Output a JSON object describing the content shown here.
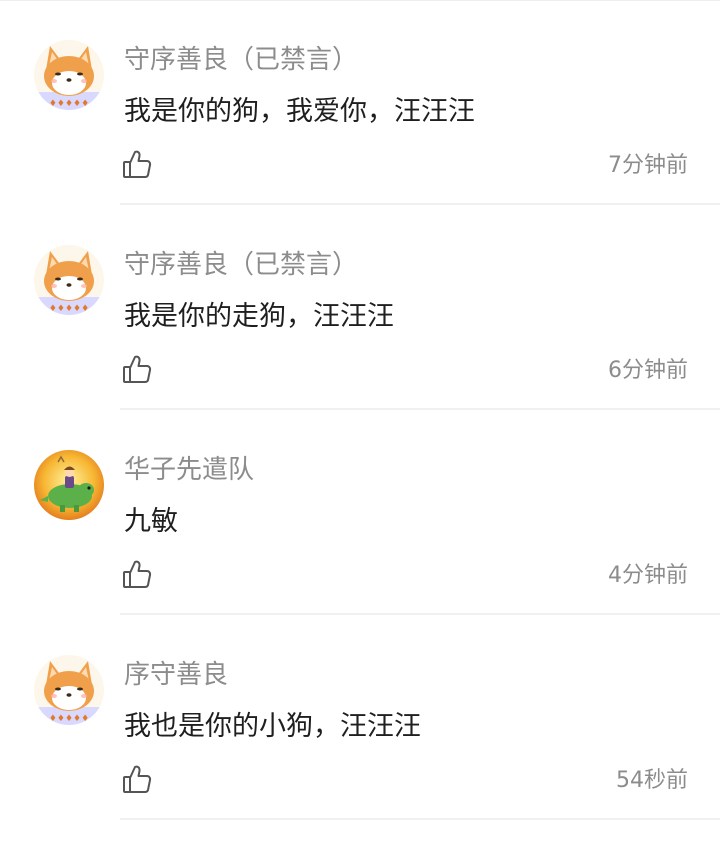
{
  "comments": [
    {
      "username": "守序善良（已禁言）",
      "content": "我是你的狗，我爱你，汪汪汪",
      "time": "7分钟前",
      "avatar": "shiba-avatar-icon"
    },
    {
      "username": "守序善良（已禁言）",
      "content": "我是你的走狗，汪汪汪",
      "time": "6分钟前",
      "avatar": "shiba-avatar-icon"
    },
    {
      "username": "华子先遣队",
      "content": "九敏",
      "time": "4分钟前",
      "avatar": "dinosaur-rider-avatar-icon"
    },
    {
      "username": "序守善良",
      "content": "我也是你的小狗，汪汪汪",
      "time": "54秒前",
      "avatar": "shiba-avatar-icon"
    }
  ],
  "icons": {
    "like": "thumbs-up-outline-icon"
  },
  "colors": {
    "username": "#8c8c8c",
    "content": "#1f1f1f",
    "time": "#8c8c8c",
    "divider": "#f0f0f0",
    "avatar_orange": "#f0a04b"
  }
}
